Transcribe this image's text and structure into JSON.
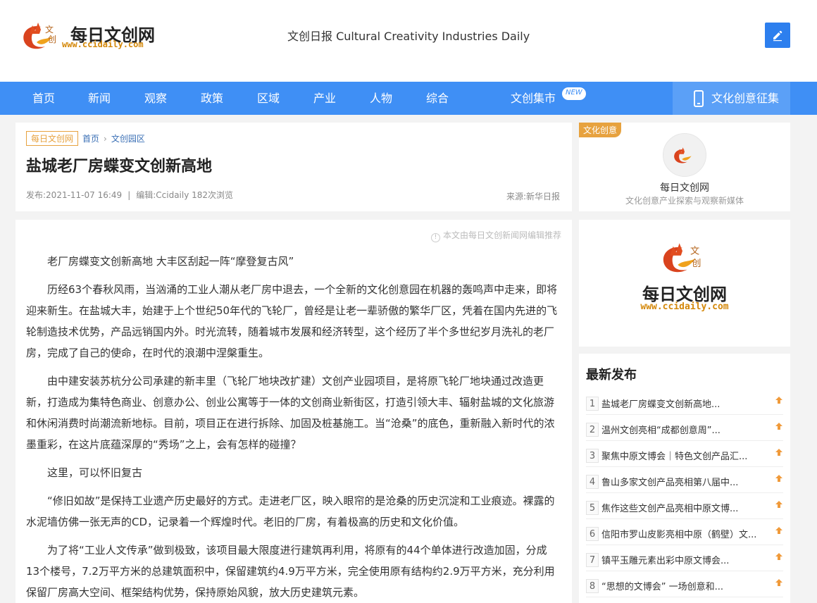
{
  "header": {
    "brand_cn": "每日文创网",
    "brand_url": "www.ccidaily.com",
    "tagline": "文创日报 Cultural Creativity Industries Daily"
  },
  "nav": {
    "items": [
      "首页",
      "新闻",
      "观察",
      "政策",
      "区域",
      "产业",
      "人物",
      "综合"
    ],
    "market": "文创集市",
    "market_badge": "NEW",
    "right": "文化创意征集"
  },
  "article": {
    "breadcrumb": [
      "每日文创网",
      "首页",
      "文创园区"
    ],
    "title": "盐城老厂房蝶变文创新高地",
    "publish": "发布:2021-11-07 16:49",
    "editor": "编辑:Ccidaily 182次浏览",
    "source": "来源:新华日报",
    "notice": "本文由每日文创新闻网编辑推荐",
    "paragraphs": [
      "老厂房蝶变文创新高地 大丰区刮起一阵“摩登复古风”",
      "历经63个春秋风雨，当汹涌的工业人潮从老厂房中退去，一个全新的文化创意园在机器的轰鸣声中走来，即将迎来新生。在盐城大丰，始建于上个世纪50年代的飞轮厂，曾经是让老一辈骄傲的繁华厂区，凭着在国内先进的飞轮制造技术优势，产品远销国内外。时光流转，随着城市发展和经济转型，这个经历了半个多世纪岁月洗礼的老厂房，完成了自己的使命，在时代的浪潮中涅槃重生。",
      "由中建安装苏杭分公司承建的新丰里（飞轮厂地块改扩建）文创产业园项目，是将原飞轮厂地块通过改造更新，打造成为集特色商业、创意办公、创业公寓等于一体的文创商业新街区，打造引领大丰、辐射盐城的文化旅游和休闲消费时尚潮流新地标。目前，项目正在进行拆除、加固及桩基施工。当“沧桑”的底色，重新融入新时代的浓墨重彩，在这片底蕴深厚的“秀场”之上，会有怎样的碰撞？",
      "这里，可以怀旧复古",
      "“修旧如故”是保持工业遗产历史最好的方式。走进老厂区，映入眼帘的是沧桑的历史沉淀和工业痕迹。裸露的水泥墙仿佛一张无声的CD，记录着一个辉煌时代。老旧的厂房，有着极高的历史和文化价值。",
      "为了将“工业人文传承”做到极致，该项目最大限度进行建筑再利用，将原有的44个单体进行改造加固，分成13个楼号，7.2万平方米的总建筑面积中，保留建筑约4.9万平方米，完全使用原有结构约2.9万平方米，充分利用保留厂房高大空间、框架结构优势，保持原始风貌，放大历史建筑元素。"
    ]
  },
  "sidebar": {
    "profile_tag": "文化创意",
    "profile_name": "每日文创网",
    "profile_desc": "文化创意产业探索与观察新媒体",
    "latest_title": "最新发布",
    "latest": [
      {
        "num": "1",
        "text": "盐城老厂房蝶变文创新高地..."
      },
      {
        "num": "2",
        "text": "温州文创亮相“成都创意周”..."
      },
      {
        "num": "3",
        "text": "聚焦中原文博会｜特色文创产品汇..."
      },
      {
        "num": "4",
        "text": "鲁山多家文创产品亮相第八届中..."
      },
      {
        "num": "5",
        "text": "焦作这些文创产品亮相中原文博..."
      },
      {
        "num": "6",
        "text": "信阳市罗山皮影亮相中原（鹤壁）文..."
      },
      {
        "num": "7",
        "text": "镇平玉雕元素出彩中原文博会..."
      },
      {
        "num": "8",
        "text": "“思想的文博会” 一场创意和..."
      }
    ]
  },
  "colors": {
    "nav_bg": "#3f8ff5",
    "accent_orange": "#e7a23f",
    "edit_button": "#2d7fee"
  }
}
